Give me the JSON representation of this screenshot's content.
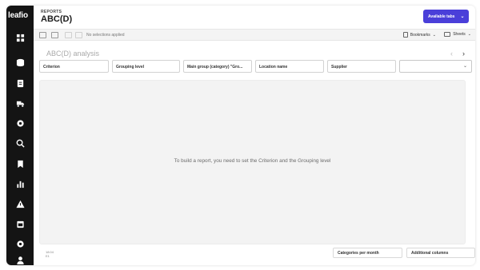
{
  "app": {
    "logo": "leafio"
  },
  "sidebar": {
    "items": [
      {
        "icon": "dashboard-icon"
      },
      {
        "icon": "database-icon"
      },
      {
        "icon": "document-icon"
      },
      {
        "icon": "delivery-truck-icon"
      },
      {
        "icon": "settings-gear-icon"
      },
      {
        "icon": "search-analytics-icon"
      },
      {
        "icon": "bookmark-icon"
      },
      {
        "icon": "bar-chart-icon"
      },
      {
        "icon": "warning-icon"
      },
      {
        "icon": "calendar-icon"
      },
      {
        "icon": "cog-icon"
      },
      {
        "icon": "user-avatar-icon"
      }
    ]
  },
  "header": {
    "section": "REPORTS",
    "title": "ABC(D)",
    "available_tabs_label": "Available tabs"
  },
  "toolbar": {
    "no_selections": "No selections applied",
    "bookmarks_label": "Bookmarks",
    "sheets_label": "Sheets"
  },
  "sheet": {
    "title": "ABC(D) analysis"
  },
  "filters": [
    {
      "label": "Criterion"
    },
    {
      "label": "Grouping level"
    },
    {
      "label": "Main group (category) \"Gro..."
    },
    {
      "label": "Location name"
    },
    {
      "label": "Supplier"
    }
  ],
  "canvas": {
    "message": "To build a report, you need to set the Criterion and the Grouping level"
  },
  "footer": {
    "time": "18:04",
    "sub": "E1",
    "categories_per_month": "Categories per month",
    "additional_columns": "Additional columns"
  },
  "colors": {
    "sidebar_bg": "#141414",
    "accent": "#4a3fd9",
    "canvas_bg": "#f3f3f3"
  }
}
